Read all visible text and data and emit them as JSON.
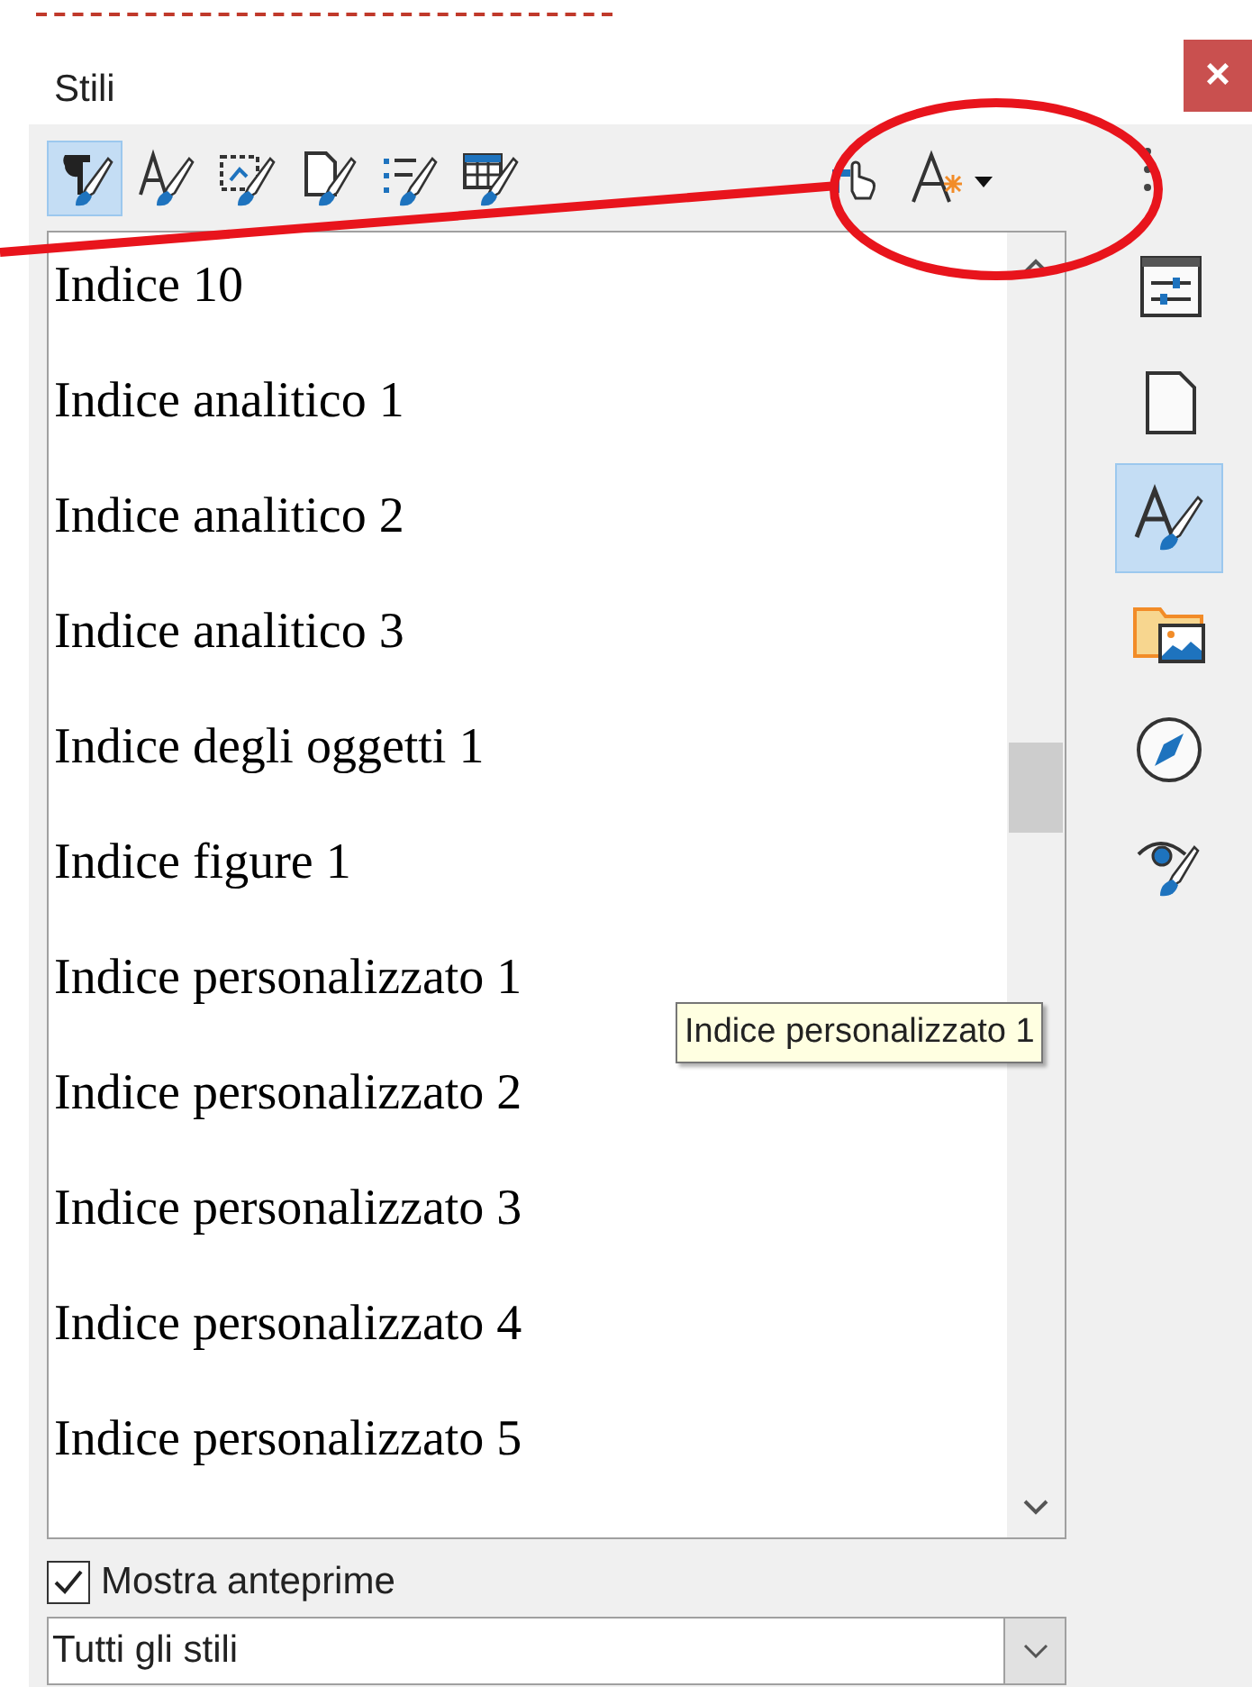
{
  "panel": {
    "title": "Stili",
    "close_label": "×"
  },
  "style_categories": [
    {
      "selected": true
    },
    {
      "selected": false
    },
    {
      "selected": false
    },
    {
      "selected": false
    },
    {
      "selected": false
    },
    {
      "selected": false
    }
  ],
  "styles_list": [
    {
      "label": "Indice 10"
    },
    {
      "label": "Indice analitico 1"
    },
    {
      "label": "Indice analitico 2"
    },
    {
      "label": "Indice analitico 3"
    },
    {
      "label": "Indice degli oggetti 1"
    },
    {
      "label": "Indice figure 1"
    },
    {
      "label": "Indice personalizzato 1"
    },
    {
      "label": "Indice personalizzato 2"
    },
    {
      "label": "Indice personalizzato 3"
    },
    {
      "label": "Indice personalizzato 4"
    },
    {
      "label": "Indice personalizzato 5"
    }
  ],
  "tooltip": "Indice personalizzato 1",
  "preview_checkbox": {
    "label": "Mostra anteprime",
    "checked": true
  },
  "filter_dropdown": {
    "value": "Tutti gli stili"
  },
  "sidebar_tabs": [
    {
      "kind": "properties",
      "selected": false
    },
    {
      "kind": "page",
      "selected": false
    },
    {
      "kind": "styles",
      "selected": true
    },
    {
      "kind": "gallery",
      "selected": false
    },
    {
      "kind": "navigator",
      "selected": false
    },
    {
      "kind": "inspector",
      "selected": false
    }
  ]
}
